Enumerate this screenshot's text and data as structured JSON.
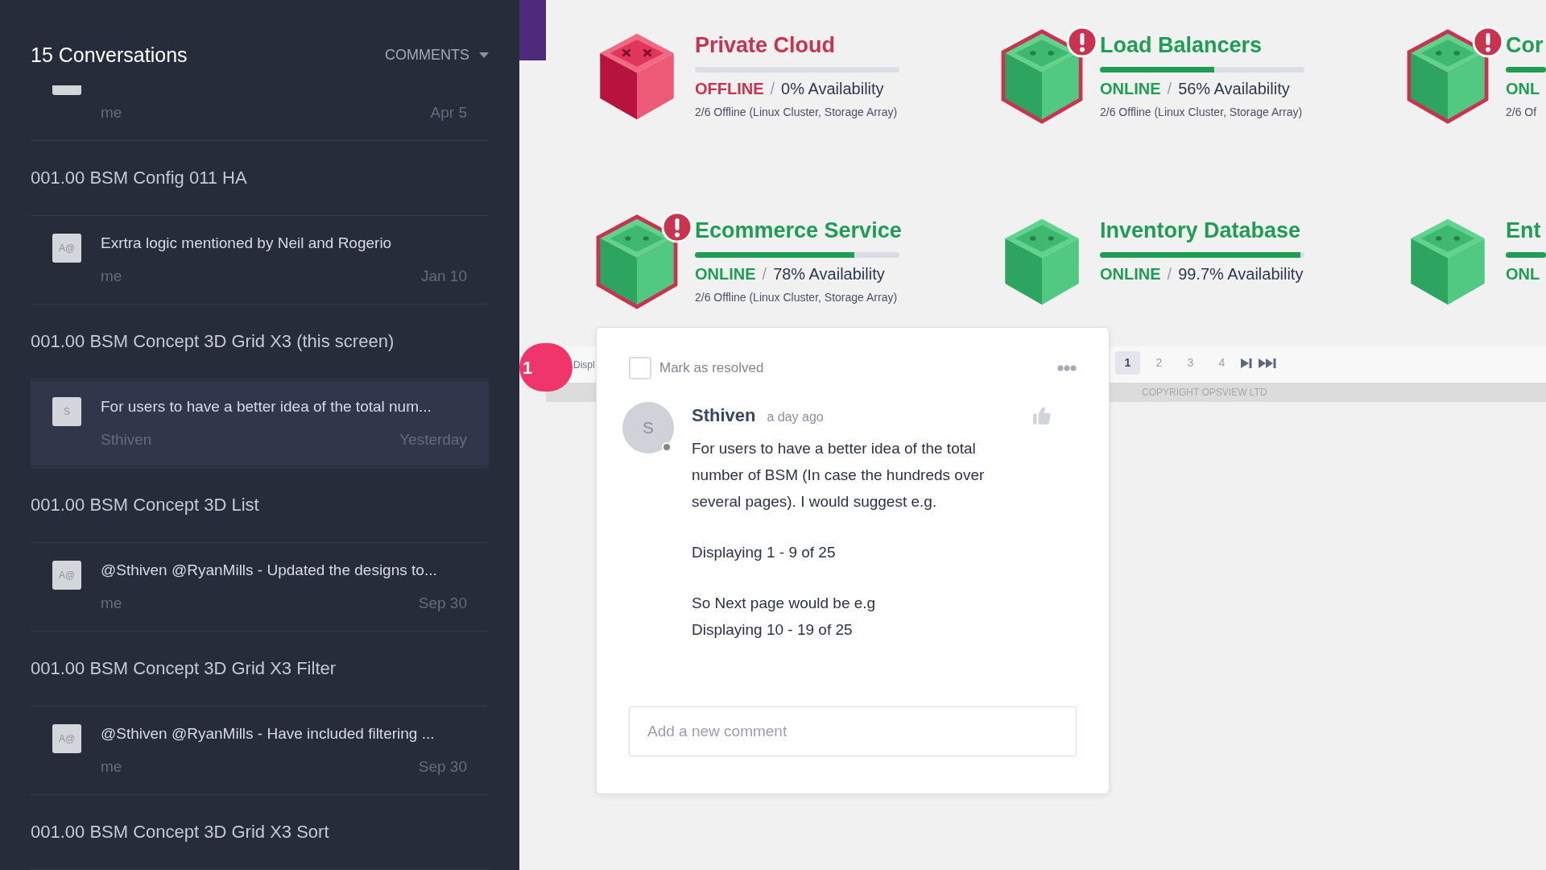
{
  "sidebar": {
    "title": "15 Conversations",
    "filter": "COMMENTS",
    "groups": [
      {
        "comments": [
          {
            "author": "me",
            "date": "Apr 5",
            "selected": false
          }
        ]
      },
      {
        "title": "001.00 BSM Config 011 HA",
        "comments": [
          {
            "avatar": "A@",
            "text": "Exrtra logic mentioned by Neil and Rogerio",
            "author": "me",
            "date": "Jan 10",
            "selected": false
          }
        ]
      },
      {
        "title": "001.00 BSM Concept 3D Grid X3 (this screen)",
        "comments": [
          {
            "avatar": "S",
            "text": "For users to have a better idea of the total num...",
            "author": "Sthiven",
            "date": "Yesterday",
            "selected": true
          }
        ]
      },
      {
        "title": "001.00 BSM Concept 3D List",
        "comments": [
          {
            "avatar": "A@",
            "text": "@Sthiven  @RyanMills  - Updated the designs to...",
            "author": "me",
            "date": "Sep 30",
            "selected": false
          }
        ]
      },
      {
        "title": "001.00 BSM Concept 3D Grid X3 Filter",
        "comments": [
          {
            "avatar": "A@",
            "text": "@Sthiven  @RyanMills  - Have included filtering ...",
            "author": "me",
            "date": "Sep 30",
            "selected": false
          }
        ]
      },
      {
        "title": "001.00 BSM Concept 3D Grid X3 Sort"
      }
    ]
  },
  "services": [
    {
      "name": "Private Cloud",
      "status": "OFFLINE",
      "kind": "offline",
      "separator": "/",
      "availability": "0% Availability",
      "detail": "2/6 Offline (Linux Cluster, Storage Array)",
      "level": 0,
      "alert": false
    },
    {
      "name": "Load Balancers",
      "status": "ONLINE",
      "kind": "online",
      "separator": "/",
      "availability": "56% Availability",
      "detail": "2/6 Offline (Linux Cluster, Storage Array)",
      "level": 0.56,
      "alert": true
    },
    {
      "name": "Cor",
      "status": "ONL",
      "kind": "online",
      "detail": "2/6 Of",
      "level": 1,
      "alert": true
    },
    {
      "name": "Ecommerce Service",
      "status": "ONLINE",
      "kind": "online",
      "separator": "/",
      "availability": "78% Availability",
      "detail": "2/6 Offline (Linux Cluster, Storage Array)",
      "level": 0.78,
      "alert": true
    },
    {
      "name": "Inventory Database",
      "status": "ONLINE",
      "kind": "online",
      "separator": "/",
      "availability": "99.7% Availability",
      "level": 0.98,
      "alert": false
    },
    {
      "name": "Ent",
      "status": "ONL",
      "kind": "online",
      "level": 1,
      "alert": false
    }
  ],
  "pager": {
    "badge": "1",
    "caption": "Displ",
    "pages": [
      {
        "label": "1",
        "selected": true
      },
      {
        "label": "2",
        "selected": false
      },
      {
        "label": "3",
        "selected": false
      },
      {
        "label": "4",
        "selected": false
      }
    ],
    "copyright": "COPYRIGHT OPSVIEW LTD"
  },
  "comment_popup": {
    "resolved": {
      "label": "Mark as resolved",
      "checked": false
    },
    "avatar": "S",
    "author": "Sthiven",
    "time": "a day ago",
    "body": [
      "For users to have a better idea of the total number of BSM (In case the hundreds over several pages). I would suggest e.g.",
      "Displaying 1 - 9 of 25",
      "So Next page would be e.g\nDisplaying 10 - 19 of 25"
    ],
    "reply": {
      "placeholder": "Add a new comment"
    }
  }
}
